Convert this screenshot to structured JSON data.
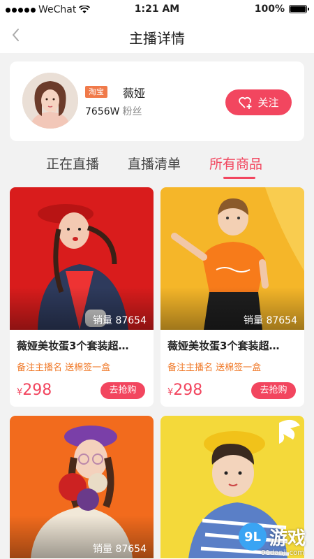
{
  "status_bar": {
    "carrier": "WeChat",
    "time": "1:21 AM",
    "battery": "100%"
  },
  "nav": {
    "title": "主播详情"
  },
  "anchor": {
    "platform": "淘宝",
    "name": "薇娅",
    "fans_count": "7656W",
    "fans_label": "粉丝",
    "follow_label": "关注"
  },
  "tabs": [
    {
      "label": "正在直播"
    },
    {
      "label": "直播清单"
    },
    {
      "label": "所有商品",
      "active": true
    }
  ],
  "products": [
    {
      "sales": "销量 87654",
      "title": "薇娅美妆蛋3个套装超…",
      "note": "备注主播名 送棉签一盒",
      "currency": "¥",
      "price": "298",
      "buy_label": "去抢购",
      "image": "girl-red-coat-photo"
    },
    {
      "sales": "销量 87654",
      "title": "薇娅美妆蛋3个套装超…",
      "note": "备注主播名 送棉签一盒",
      "currency": "¥",
      "price": "298",
      "buy_label": "去抢购",
      "image": "boy-orange-tshirt-photo"
    },
    {
      "sales": "销量 87654",
      "title": "",
      "note": "",
      "currency": "",
      "price": "",
      "buy_label": "",
      "image": "girl-purple-beret-photo"
    },
    {
      "sales": "",
      "title": "",
      "note": "",
      "currency": "",
      "price": "",
      "buy_label": "",
      "image": "boy-yellow-hat-photo"
    }
  ],
  "watermark": {
    "text": "游戏",
    "logo": "9L",
    "url": "91danji.com"
  },
  "colors": {
    "accent": "#f2465f",
    "note": "#f07a2a",
    "background": "#f2f2f2"
  }
}
